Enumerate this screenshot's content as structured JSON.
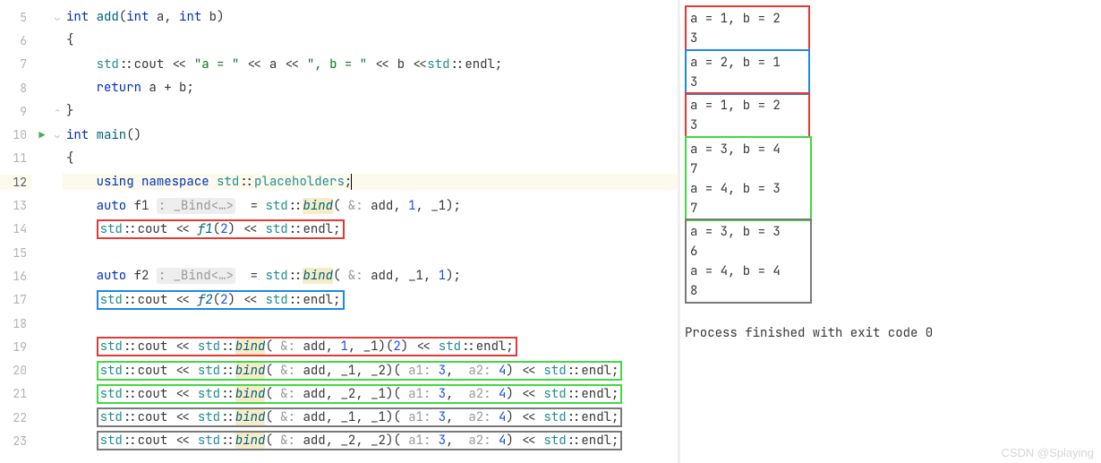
{
  "lines": [
    {
      "n": "5",
      "fold": "⌄",
      "html": "<span class='kw'>int</span> <span class='fn'>add</span>(<span class='kw'>int</span> <span class='id'>a</span>, <span class='kw'>int</span> <span class='id'>b</span>)"
    },
    {
      "n": "6",
      "fold": "",
      "html": "{"
    },
    {
      "n": "7",
      "fold": "",
      "indent": "    ",
      "html": "<span class='ns'>std</span>::<span class='id'>cout</span> &lt;&lt; <span class='str'>\"a = \"</span> &lt;&lt; <span class='id'>a</span> &lt;&lt; <span class='str'>\", b = \"</span> &lt;&lt; <span class='id'>b</span> &lt;&lt;<span class='ns'>std</span>::<span class='id'>endl</span>;"
    },
    {
      "n": "8",
      "fold": "",
      "indent": "    ",
      "html": "<span class='kw'>return</span> <span class='id'>a</span> + <span class='id'>b</span>;"
    },
    {
      "n": "9",
      "fold": "⌃",
      "html": "}"
    },
    {
      "n": "10",
      "fold": "⌄",
      "run": true,
      "html": "<span class='kw'>int</span> <span class='fn'>main</span>()"
    },
    {
      "n": "11",
      "fold": "",
      "html": "{"
    },
    {
      "n": "12",
      "fold": "",
      "hl": true,
      "indent": "    ",
      "html": "<span class='kw'>using</span> <span class='kw'>namespace</span> <span class='ns'>std</span>::<span class='ns'>placeholders</span>;<span class='cursor'></span>"
    },
    {
      "n": "13",
      "fold": "",
      "indent": "    ",
      "html": "<span class='kw'>auto</span> <span class='id'>f1</span> <span class='hint hintbg'>: _Bind&lt;…&gt;</span>  = <span class='ns'>std</span>::<span class='bindhi'><span class='fnit'>bind</span></span>( <span class='hint'>&amp;:</span> <span class='id'>add</span>, <span class='num'>1</span>, <span class='id'>_1</span>);"
    },
    {
      "n": "14",
      "fold": "",
      "indent": "    ",
      "html": "<span class='box box-red'><span class='ns'>std</span>::<span class='id'>cout</span> &lt;&lt; <span class='fnit'>f1</span>(<span class='num'>2</span>) &lt;&lt; <span class='ns'>std</span>::<span class='id'>endl</span>;</span>"
    },
    {
      "n": "15",
      "fold": "",
      "html": ""
    },
    {
      "n": "16",
      "fold": "",
      "indent": "    ",
      "html": "<span class='kw'>auto</span> <span class='id'>f2</span> <span class='hint hintbg'>: _Bind&lt;…&gt;</span>  = <span class='ns'>std</span>::<span class='bindhi'><span class='fnit'>bind</span></span>( <span class='hint'>&amp;:</span> <span class='id'>add</span>, <span class='id'>_1</span>, <span class='num'>1</span>);"
    },
    {
      "n": "17",
      "fold": "",
      "indent": "    ",
      "html": "<span class='box box-blue'><span class='ns'>std</span>::<span class='id'>cout</span> &lt;&lt; <span class='fnit'>f2</span>(<span class='num'>2</span>) &lt;&lt; <span class='ns'>std</span>::<span class='id'>endl</span>;</span>"
    },
    {
      "n": "18",
      "fold": "",
      "html": ""
    },
    {
      "n": "19",
      "fold": "",
      "indent": "    ",
      "html": "<span class='box box-red'><span class='ns'>std</span>::<span class='id'>cout</span> &lt;&lt; <span class='ns'>std</span>::<span class='bindhi'><span class='fnit'>bind</span></span>( <span class='hint'>&amp;:</span> <span class='id'>add</span>, <span class='num'>1</span>, <span class='id'>_1</span>)(<span class='num'>2</span>) &lt;&lt; <span class='ns'>std</span>::<span class='id'>endl</span>;</span>"
    },
    {
      "n": "20",
      "fold": "",
      "indent": "    ",
      "html": "<span class='box box-green'><span class='ns'>std</span>::<span class='id'>cout</span> &lt;&lt; <span class='ns'>std</span>::<span class='bindhi'><span class='fnit'>bind</span></span>( <span class='hint'>&amp;:</span> <span class='id'>add</span>, <span class='id'>_1</span>, <span class='id'>_2</span>)( <span class='hint'>a1:</span> <span class='num'>3</span>,  <span class='hint'>a2:</span> <span class='num'>4</span>) &lt;&lt; <span class='ns'>std</span>::<span class='id'>endl</span>;</span>"
    },
    {
      "n": "21",
      "fold": "",
      "indent": "    ",
      "html": "<span class='box box-green'><span class='ns'>std</span>::<span class='id'>cout</span> &lt;&lt; <span class='ns'>std</span>::<span class='bindhi'><span class='fnit'>bind</span></span>( <span class='hint'>&amp;:</span> <span class='id'>add</span>, <span class='id'>_2</span>, <span class='id'>_1</span>)( <span class='hint'>a1:</span> <span class='num'>3</span>,  <span class='hint'>a2:</span> <span class='num'>4</span>) &lt;&lt; <span class='ns'>std</span>::<span class='id'>endl</span>;</span>"
    },
    {
      "n": "22",
      "fold": "",
      "indent": "    ",
      "html": "<span class='box box-gray'><span class='ns'>std</span>::<span class='id'>cout</span> &lt;&lt; <span class='ns'>std</span>::<span class='bindhi'><span class='fnit'>bind</span></span>( <span class='hint'>&amp;:</span> <span class='id'>add</span>, <span class='id'>_1</span>, <span class='id'>_1</span>)( <span class='hint'>a1:</span> <span class='num'>3</span>,  <span class='hint'>a2:</span> <span class='num'>4</span>) &lt;&lt; <span class='ns'>std</span>::<span class='id'>endl</span>;</span>"
    },
    {
      "n": "23",
      "fold": "",
      "indent": "    ",
      "html": "<span class='box box-gray'><span class='ns'>std</span>::<span class='id'>cout</span> &lt;&lt; <span class='ns'>std</span>::<span class='bindhi'><span class='fnit'>bind</span></span>( <span class='hint'>&amp;:</span> <span class='id'>add</span>, <span class='id'>_2</span>, <span class='id'>_2</span>)( <span class='hint'>a1:</span> <span class='num'>3</span>,  <span class='hint'>a2:</span> <span class='num'>4</span>) &lt;&lt; <span class='ns'>std</span>::<span class='id'>endl</span>;</span>"
    }
  ],
  "output": {
    "groups": [
      {
        "cls": "obox-red",
        "lines": [
          "a = 1, b = 2",
          "3"
        ]
      },
      {
        "cls": "obox-blue",
        "lines": [
          "a = 2, b = 1",
          "3"
        ]
      },
      {
        "cls": "obox-red",
        "lines": [
          "a = 1, b = 2",
          "3"
        ]
      },
      {
        "cls": "obox-green",
        "lines": [
          "a = 3, b = 4",
          "7",
          "a = 4, b = 3",
          "7"
        ]
      },
      {
        "cls": "obox-gray",
        "lines": [
          "a = 3, b = 3",
          "6",
          "a = 4, b = 4",
          "8"
        ]
      }
    ],
    "process": "Process finished with exit code 0"
  },
  "watermark": "CSDN @Splaying"
}
